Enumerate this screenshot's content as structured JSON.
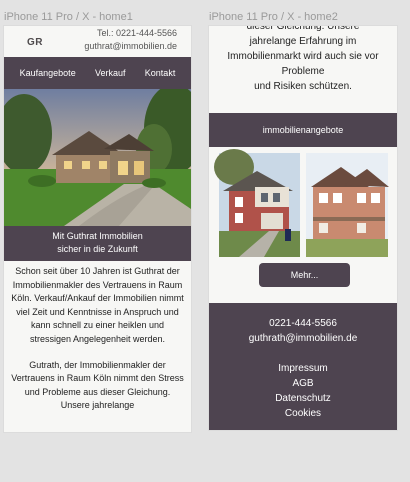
{
  "frames": [
    {
      "label": "iPhone 11 Pro / X - home1"
    },
    {
      "label": "iPhone 11 Pro / X - home2"
    }
  ],
  "home1": {
    "logo": "GR",
    "phone": "Tel.: 0221-444-5566",
    "email": "guthrat@immobilien.de",
    "nav": [
      "Kaufangebote",
      "Verkauf",
      "Kontakt"
    ],
    "banner_line1": "Mit Guthrat Immobilien",
    "banner_line2": "sicher in die Zukunft",
    "paragraphs": [
      "Schon seit über 10 Jahren ist Guthrat der Immobilienmakler des Vertrauens in Raum Köln. Verkauf/Ankauf der Immobilien nimmt viel Zeit und Kenntnisse in Anspruch und kann schnell zu einer heiklen und stressigen Angelegenheit werden.",
      "Gutrath, der Immobilienmakler der Vertrauens in Raum Köln nimmt den Stress und Probleme aus dieser Gleichung. Unsere jahrelange"
    ]
  },
  "home2": {
    "text_lines": [
      "dieser Gleichung. Unsere",
      "jahrelange Erfahrung im",
      "Immobilienmarkt wird auch sie vor",
      "Probleme",
      "und Risiken schützen."
    ],
    "section_title": "immobilienangebote",
    "more_button": "Mehr...",
    "footer": {
      "phone": "0221-444-5566",
      "email": "guthrath@immobilien.de",
      "links": [
        "Impressum",
        "AGB",
        "Datenschutz",
        "Cookies"
      ]
    }
  }
}
